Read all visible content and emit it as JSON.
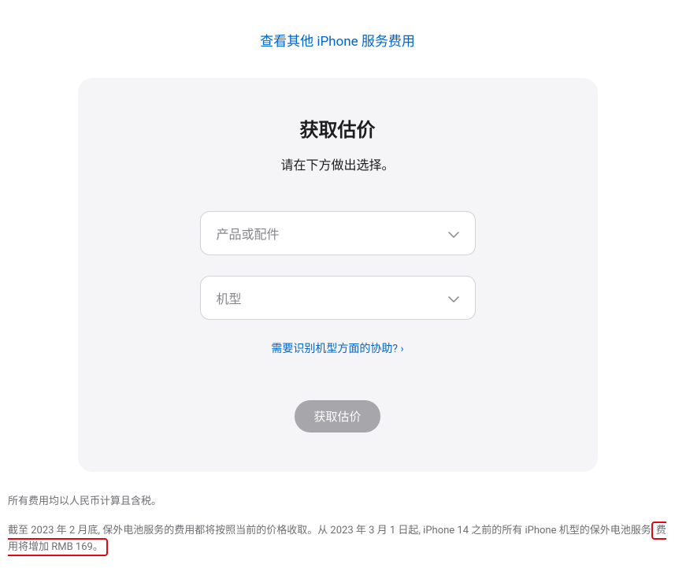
{
  "topLink": "查看其他 iPhone 服务费用",
  "card": {
    "title": "获取估价",
    "subtitle": "请在下方做出选择。",
    "select1Placeholder": "产品或配件",
    "select2Placeholder": "机型",
    "helpLink": "需要识别机型方面的协助?",
    "button": "获取估价"
  },
  "footnote": {
    "line1": "所有费用均以人民币计算且含税。",
    "line2Part1": "截至 2023 年 2 月底, 保外电池服务的费用都将按照当前的价格收取。从 2023 年 3 月 1 日起, iPhone 14 之前的所有 iPhone 机型的保外电池服务",
    "line2Highlighted": "费用将增加 RMB 169。"
  }
}
